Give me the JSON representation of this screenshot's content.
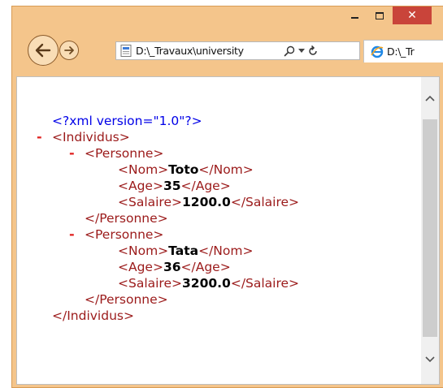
{
  "window": {
    "controls": {
      "minimize_icon": "minimize-icon",
      "maximize_icon": "maximize-icon",
      "close_glyph": "✕"
    }
  },
  "nav": {
    "back_icon": "back-arrow-icon",
    "forward_icon": "forward-arrow-icon",
    "address": "D:\\_Travaux\\university",
    "tab_title": "D:\\_Tr"
  },
  "xml": {
    "declaration": "<?xml version=\"1.0\"?>",
    "collapse_marker": "-",
    "root_open": "<Individus>",
    "root_close": "</Individus>",
    "person_open": "<Personne>",
    "person_close": "</Personne>",
    "persons": [
      {
        "fields": [
          {
            "open": "<Nom>",
            "value": "Toto",
            "close": "</Nom>"
          },
          {
            "open": "<Age>",
            "value": "35",
            "close": "</Age>"
          },
          {
            "open": "<Salaire>",
            "value": "1200.0",
            "close": "</Salaire>"
          }
        ]
      },
      {
        "fields": [
          {
            "open": "<Nom>",
            "value": "Tata",
            "close": "</Nom>"
          },
          {
            "open": "<Age>",
            "value": "36",
            "close": "</Age>"
          },
          {
            "open": "<Salaire>",
            "value": "3200.0",
            "close": "</Salaire>"
          }
        ]
      }
    ]
  },
  "colors": {
    "frame": "#f4c58b",
    "close_button": "#c9443a",
    "xml_declaration": "#0000e8",
    "xml_tag": "#9b1a1a",
    "collapse_marker": "#e0201f"
  }
}
